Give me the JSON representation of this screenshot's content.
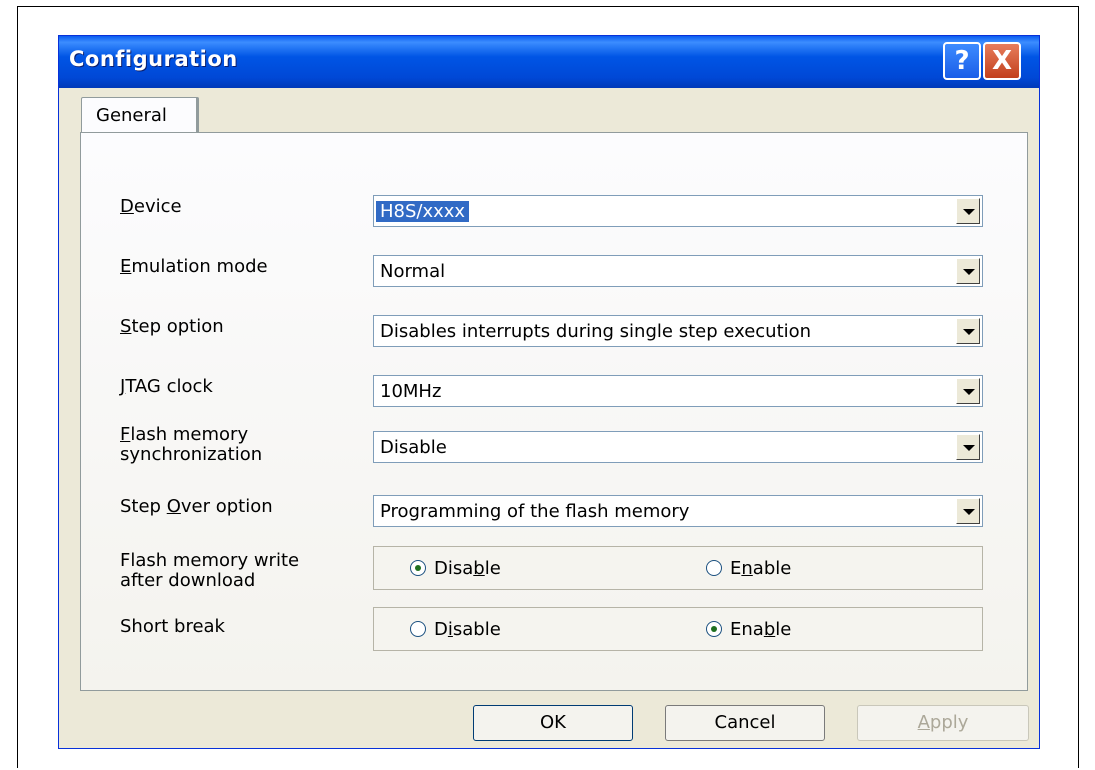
{
  "window": {
    "title": "Configuration",
    "help_label": "?",
    "close_label": "X"
  },
  "tabs": [
    {
      "label": "General"
    }
  ],
  "fields": {
    "device": {
      "label_pre": "",
      "label_key": "D",
      "label_post": "evice",
      "value": "H8S/xxxx"
    },
    "emulation_mode": {
      "label_pre": "",
      "label_key": "E",
      "label_post": "mulation mode",
      "value": "Normal"
    },
    "step_option": {
      "label_pre": "",
      "label_key": "S",
      "label_post": "tep option",
      "value": "Disables interrupts during single step execution"
    },
    "jtag_clock": {
      "label_pre": "",
      "label_key": "J",
      "label_post": "TAG clock",
      "value": "10MHz"
    },
    "flash_sync": {
      "label_line1_key": "F",
      "label_line1_post": "lash memory",
      "label_line2": "synchronization",
      "value": "Disable"
    },
    "step_over": {
      "label_pre": "Step ",
      "label_key": "O",
      "label_post": "ver option",
      "value": "Programming of the flash memory"
    }
  },
  "radios": {
    "flash_write": {
      "label_line1": "Flash memory write",
      "label_line2": "after download",
      "disable": {
        "pre": "Disa",
        "key": "b",
        "post": "le",
        "checked": true
      },
      "enable": {
        "pre": "E",
        "key": "n",
        "post": "able",
        "checked": false
      }
    },
    "short_break": {
      "label": "Short break",
      "disable": {
        "pre": "D",
        "key": "i",
        "post": "sable",
        "checked": false
      },
      "enable": {
        "pre": "Ena",
        "key": "b",
        "post": "le",
        "checked": true
      }
    }
  },
  "buttons": {
    "ok": "OK",
    "cancel": "Cancel",
    "apply_key": "A",
    "apply_post": "pply"
  }
}
